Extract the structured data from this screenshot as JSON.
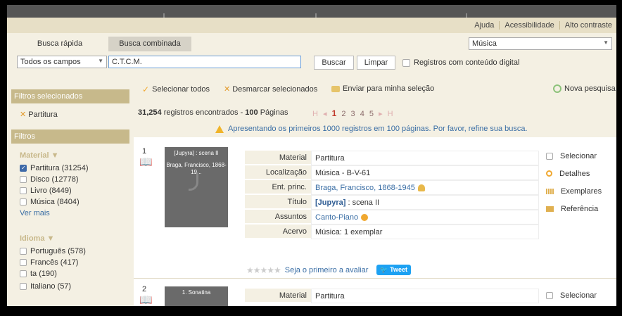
{
  "top_links": [
    "Ajuda",
    "Acessibilidade",
    "Alto contraste"
  ],
  "tabs": [
    "Busca rápida",
    "Busca combinada"
  ],
  "collection_select": "Música",
  "search": {
    "field_select": "Todos os campos",
    "query": "C.T.C.M.",
    "buscar": "Buscar",
    "limpar": "Limpar",
    "digital_label": "Registros com conteúdo digital"
  },
  "sidebar": {
    "filtros_selecionados": "Filtros selecionados",
    "selected_filter": "Partitura",
    "filtros": "Filtros",
    "material_title": "Material ▼",
    "material_items": [
      "Partitura (31254)",
      "Disco (12778)",
      "Livro (8449)",
      "Música (8404)"
    ],
    "ver_mais": "Ver mais",
    "idioma_title": "Idioma ▼",
    "idioma_items": [
      "Português (578)",
      "Francês (417)",
      "ta (190)",
      "Italiano (57)"
    ]
  },
  "toolbar": {
    "selecionar_todos": "Selecionar todos",
    "desmarcar": "Desmarcar selecionados",
    "enviar": "Enviar para minha seleção",
    "nova_pesquisa": "Nova pesquisa"
  },
  "results": {
    "count_bold": "31,254",
    "count_text": "registros encontrados",
    "pages_sep": "-",
    "pages_bold": "100",
    "pages_text": "Páginas",
    "pager_first": "H",
    "pager_prev": "◂",
    "current_page": "1",
    "pages": "2 3 4 5",
    "pager_next": "▸",
    "pager_last": "H",
    "warning": "Apresentando os primeiros 1000 registros em 100 páginas. Por favor, refine sua busca."
  },
  "records": [
    {
      "number": "1",
      "thumb_title": "[Jupyra] : scena II",
      "thumb_author": "Braga, Francisco, 1868-19...",
      "fields": [
        {
          "label": "Material",
          "value": "Partitura"
        },
        {
          "label": "Localização",
          "value": "Música - B-V-61"
        },
        {
          "label": "Ent. princ.",
          "value": "Braga, Francisco, 1868-1945"
        },
        {
          "label": "Título",
          "value_bold": "[Jupyra]",
          "value": " : scena II"
        },
        {
          "label": "Assuntos",
          "value": "Canto-Piano"
        },
        {
          "label": "Acervo",
          "value": "Música: 1 exemplar"
        }
      ],
      "rating_text": "Seja o primeiro a avaliar",
      "tweet": "Tweet",
      "actions": [
        "Selecionar",
        "Detalhes",
        "Exemplares",
        "Referência"
      ]
    },
    {
      "number": "2",
      "thumb_title": "1. Sonatina",
      "fields": [
        {
          "label": "Material",
          "value": "Partitura"
        }
      ],
      "actions": [
        "Selecionar"
      ]
    }
  ]
}
